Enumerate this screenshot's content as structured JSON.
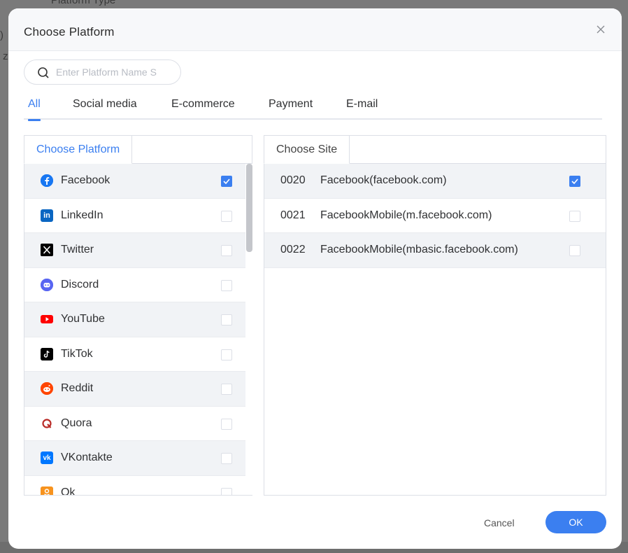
{
  "background": {
    "fragment_top": "Platform Type",
    "fragment_left_1": ")",
    "fragment_left_2": "z"
  },
  "modal": {
    "title": "Choose Platform",
    "close_icon": "close-icon"
  },
  "search": {
    "placeholder": "Enter Platform Name S",
    "value": ""
  },
  "tabs": [
    {
      "label": "All",
      "active": true
    },
    {
      "label": "Social media",
      "active": false
    },
    {
      "label": "E-commerce",
      "active": false
    },
    {
      "label": "Payment",
      "active": false
    },
    {
      "label": "E-mail",
      "active": false
    }
  ],
  "platform_panel": {
    "tab_label": "Choose Platform",
    "items": [
      {
        "label": "Facebook",
        "icon": "facebook-icon",
        "checked": true
      },
      {
        "label": "LinkedIn",
        "icon": "linkedin-icon",
        "checked": false
      },
      {
        "label": "Twitter",
        "icon": "x-twitter-icon",
        "checked": false
      },
      {
        "label": "Discord",
        "icon": "discord-icon",
        "checked": false
      },
      {
        "label": "YouTube",
        "icon": "youtube-icon",
        "checked": false
      },
      {
        "label": "TikTok",
        "icon": "tiktok-icon",
        "checked": false
      },
      {
        "label": "Reddit",
        "icon": "reddit-icon",
        "checked": false
      },
      {
        "label": "Quora",
        "icon": "quora-icon",
        "checked": false
      },
      {
        "label": "VKontakte",
        "icon": "vk-icon",
        "checked": false
      },
      {
        "label": "Ok",
        "icon": "odnoklassniki-icon",
        "checked": false
      }
    ]
  },
  "site_panel": {
    "tab_label": "Choose Site",
    "items": [
      {
        "code": "0020",
        "name": "Facebook(facebook.com)",
        "checked": true
      },
      {
        "code": "0021",
        "name": "FacebookMobile(m.facebook.com)",
        "checked": false
      },
      {
        "code": "0022",
        "name": "FacebookMobile(mbasic.facebook.com)",
        "checked": false
      }
    ]
  },
  "footer": {
    "cancel_label": "Cancel",
    "ok_label": "OK"
  },
  "colors": {
    "accent": "#3b7ff0",
    "row_shade": "#f1f3f6"
  }
}
